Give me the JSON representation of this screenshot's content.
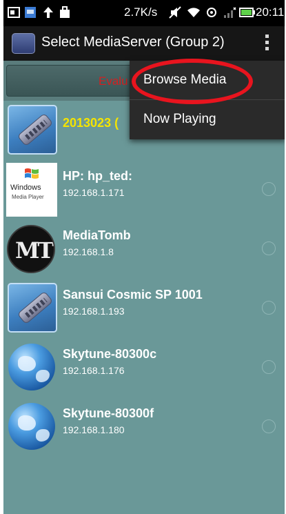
{
  "status_bar": {
    "speed": "2.7K/s",
    "time": "20:11"
  },
  "action_bar": {
    "title": "Select MediaServer (Group 2)"
  },
  "evaluate_button": {
    "label": "Evalu"
  },
  "servers": [
    {
      "name": "2013023 (",
      "ip": "",
      "icon": "remote-control-icon",
      "name_color": "#f5e400"
    },
    {
      "name": "HP: hp_ted:",
      "ip": "192.168.1.171",
      "icon": "windows-media-player-icon"
    },
    {
      "name": "MediaTomb",
      "ip": "192.168.1.8",
      "icon": "mediatomb-icon"
    },
    {
      "name": "Sansui Cosmic SP 1001",
      "ip": "192.168.1.193",
      "icon": "remote-control-icon"
    },
    {
      "name": "Skytune-80300c",
      "ip": "192.168.1.176",
      "icon": "globe-icon"
    },
    {
      "name": "Skytune-80300f",
      "ip": "192.168.1.180",
      "icon": "globe-icon"
    }
  ],
  "wmp_logo": {
    "line1": "Windows",
    "line2": "Media Player"
  },
  "mediatomb_logo": "MT",
  "popup_menu": {
    "items": [
      "Browse Media",
      "Now Playing"
    ]
  },
  "colors": {
    "list_background": "#6a9898",
    "highlight_ring": "#e8141e",
    "evaluate_text": "#d42020"
  }
}
